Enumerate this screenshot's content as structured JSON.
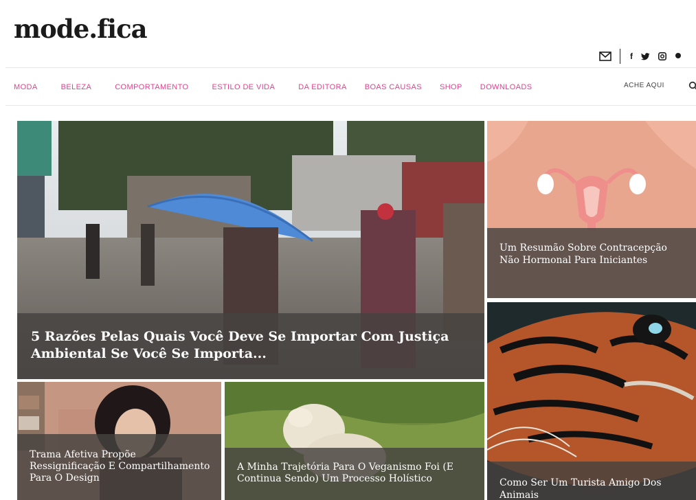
{
  "header": {
    "logo": "mode.fica"
  },
  "social": {
    "email_icon": "envelope-icon",
    "facebook_label": "f",
    "icons": [
      "envelope-icon",
      "facebook-icon",
      "twitter-icon",
      "instagram-icon",
      "pinterest-icon"
    ]
  },
  "nav": {
    "items": [
      {
        "label": "MODA"
      },
      {
        "label": "BELEZA"
      },
      {
        "label": "COMPORTAMENTO"
      },
      {
        "label": "ESTILO DE VIDA"
      },
      {
        "label": "DA EDITORA"
      },
      {
        "label": "BOAS CAUSAS"
      },
      {
        "label": "SHOP"
      },
      {
        "label": "DOWNLOADS"
      }
    ],
    "search_label": "ACHE AQUI",
    "search_icon": "search-icon"
  },
  "articles": {
    "main": {
      "title": "5 Razões Pelas Quais Você Deve Se Importar Com Justiça Ambiental Se Você Se Importa..."
    },
    "right_top": {
      "title": "Um Resumão Sobre Contracepção Não Hormonal Para Iniciantes"
    },
    "right_bottom": {
      "title": "Como Ser Um Turista Amigo Dos Animais"
    },
    "bottom_left": {
      "title": "Trama Afetiva Propõe Ressignificação E Compartilhamento Para O Design"
    },
    "bottom_middle": {
      "title": "A Minha Trajetória Para O Veganismo Foi (E Continua Sendo) Um Processo Holístico"
    }
  },
  "colors": {
    "nav_pink": "#e23f8f",
    "overlay": "#464240",
    "logo": "#1b1b1b"
  }
}
